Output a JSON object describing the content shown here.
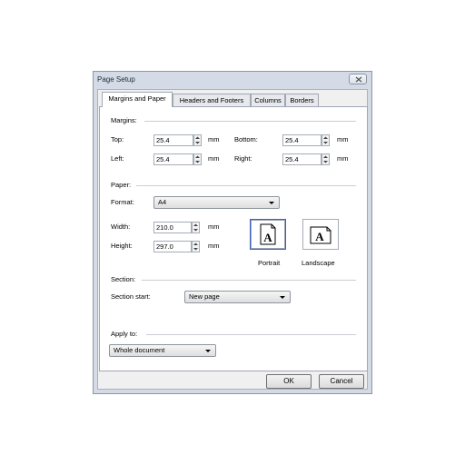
{
  "dialog": {
    "title": "Page Setup"
  },
  "tabs": [
    "Margins and Paper",
    "Headers and Footers",
    "Columns",
    "Borders"
  ],
  "margins": {
    "section_label": "Margins:",
    "top_label": "Top:",
    "top_value": "25.4",
    "bottom_label": "Bottom:",
    "bottom_value": "25.4",
    "left_label": "Left:",
    "left_value": "25.4",
    "right_label": "Right:",
    "right_value": "25.4",
    "unit": "mm"
  },
  "paper": {
    "section_label": "Paper:",
    "format_label": "Format:",
    "format_value": "A4",
    "width_label": "Width:",
    "width_value": "210.0",
    "height_label": "Height:",
    "height_value": "297.0",
    "unit": "mm",
    "portrait_label": "Portrait",
    "landscape_label": "Landscape",
    "selected_orientation": "Portrait"
  },
  "section": {
    "section_label": "Section:",
    "start_label": "Section start:",
    "start_value": "New page"
  },
  "apply": {
    "label": "Apply to:",
    "value": "Whole document"
  },
  "buttons": {
    "ok": "OK",
    "cancel": "Cancel"
  },
  "colors": {
    "dialog_bg": "#d4dbe6",
    "selected_border": "#3a5fcd"
  }
}
